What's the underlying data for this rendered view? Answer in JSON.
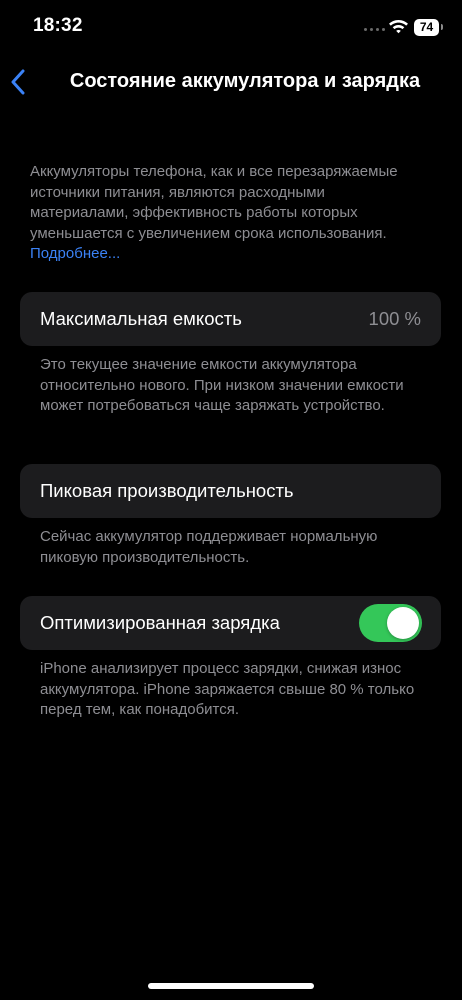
{
  "status_bar": {
    "time": "18:32",
    "battery_level": "74"
  },
  "nav": {
    "title": "Состояние аккумулятора и зарядка"
  },
  "intro": {
    "text": "Аккумуляторы телефона, как и все перезаряжаемые источники питания, являются расходными материалами, эффективность работы которых уменьшается с увеличением срока использования.",
    "link_label": "Подробнее..."
  },
  "max_capacity": {
    "label": "Максимальная емкость",
    "value": "100 %",
    "footer": "Это текущее значение емкости аккумулятора относительно нового. При низком значении емкости может потребоваться чаще заряжать устройство."
  },
  "peak_performance": {
    "label": "Пиковая производительность",
    "footer": "Сейчас аккумулятор поддерживает нормальную пиковую производительность."
  },
  "optimized_charging": {
    "label": "Оптимизированная зарядка",
    "enabled": true,
    "footer": "iPhone анализирует процесс зарядки, снижая износ аккумулятора. iPhone заряжается свыше 80 % только перед тем, как понадобится."
  },
  "colors": {
    "background": "#000000",
    "cell_background": "#1c1c1e",
    "secondary_text": "#8e8e93",
    "link": "#3b82f6",
    "toggle_on": "#34c759"
  },
  "icons": {
    "back": "chevron-left-icon",
    "wifi": "wifi-icon",
    "battery": "battery-icon",
    "signal": "signal-dots-icon"
  }
}
